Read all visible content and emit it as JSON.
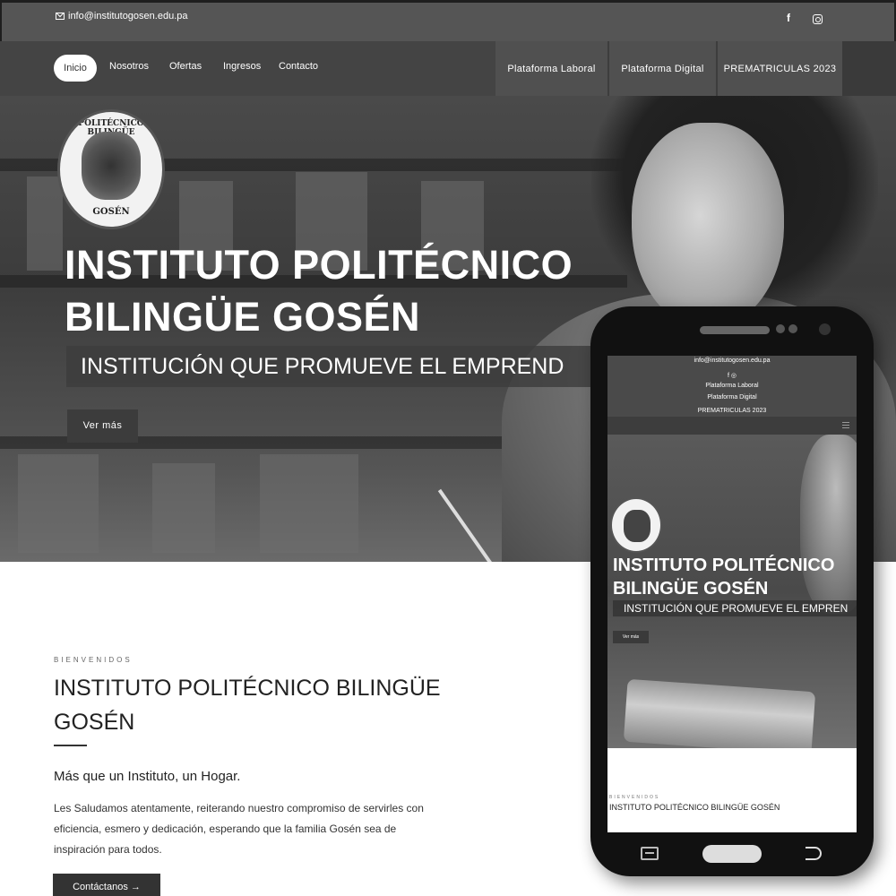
{
  "topbar": {
    "email": "info@institutogosen.edu.pa",
    "social": [
      "facebook-icon",
      "instagram-icon"
    ],
    "facebook_glyph": "f"
  },
  "nav": {
    "active": "Inicio",
    "links": [
      "Nosotros",
      "Ofertas",
      "Ingresos",
      "Contacto"
    ],
    "platforms": [
      "Plataforma Laboral",
      "Plataforma Digital",
      "PREMATRICULAS 2023"
    ]
  },
  "logo": {
    "top_text": "POLITÉCNICO BILINGÜE",
    "bottom_text": "GOSÉN"
  },
  "hero": {
    "title_line1": "INSTITUTO POLITÉCNICO",
    "title_line2": "BILINGÜE GOSÉN",
    "subtitle": "INSTITUCIÓN QUE PROMUEVE EL EMPREND",
    "button": "Ver más"
  },
  "welcome": {
    "kicker": "BIENVENIDOS",
    "title": "INSTITUTO POLITÉCNICO BILINGÜE GOSÉN",
    "tagline": "Más que un Instituto, un Hogar.",
    "body": "Les Saludamos atentamente, reiterando nuestro compromiso de servirles con eficiencia, esmero y dedicación, esperando que la familia Gosén sea de inspiración para todos.",
    "button": "Contáctanos →"
  },
  "mobile": {
    "email": "info@institutogosen.edu.pa",
    "social_text": "f  ◎",
    "links": [
      "Plataforma Laboral",
      "Plataforma Digital",
      "PREMATRICULAS 2023"
    ],
    "hero_title_line1": "INSTITUTO POLITÉCNICO",
    "hero_title_line2": "BILINGÜE GOSÉN",
    "hero_subtitle": "INSTITUCIÓN QUE PROMUEVE EL EMPREN",
    "hero_button": "Ver más",
    "kicker": "BIENVENIDOS",
    "content_title": "INSTITUTO POLITÉCNICO BILINGÜE GOSÉN"
  },
  "colors": {
    "topbar": "#555555",
    "navbar": "#3d3d3d",
    "platform_tab": "#505050",
    "button_dark": "#333333"
  }
}
